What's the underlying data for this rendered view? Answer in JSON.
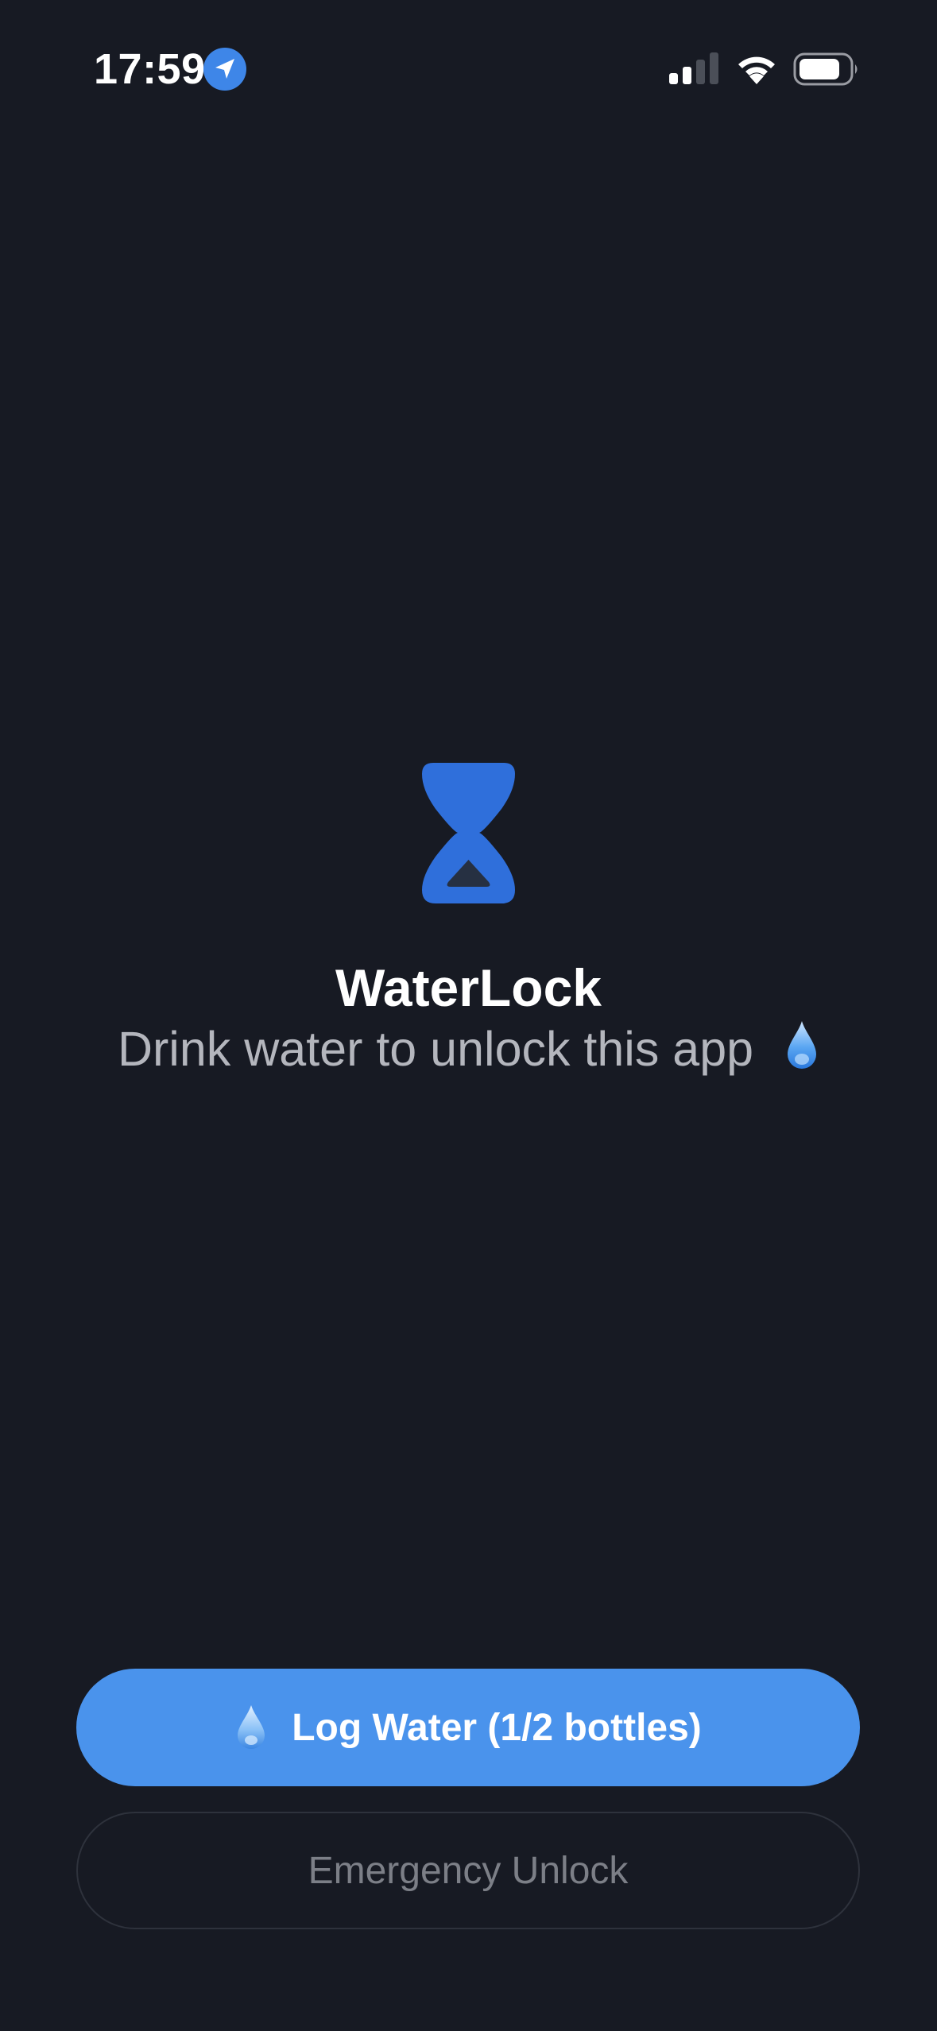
{
  "status_bar": {
    "time": "17:59",
    "location_icon": "location-arrow-icon",
    "signal_icon": "cellular-signal-icon",
    "signal_bars_active": 2,
    "signal_bars_total": 4,
    "wifi_icon": "wifi-icon",
    "battery_icon": "battery-icon"
  },
  "lock_screen": {
    "icon": "hourglass-icon",
    "title": "WaterLock",
    "subtitle": "Drink water to unlock this app",
    "subtitle_icon": "water-drop-icon"
  },
  "actions": {
    "log_water_label": "Log Water (1/2 bottles)",
    "log_water_icon": "water-drop-icon",
    "emergency_unlock_label": "Emergency Unlock"
  },
  "colors": {
    "background": "#171a23",
    "accent": "#4a93ec",
    "hourglass": "#2f6fdb",
    "subtitle_text": "#b4b6bd",
    "muted_text": "#7c7f87"
  }
}
